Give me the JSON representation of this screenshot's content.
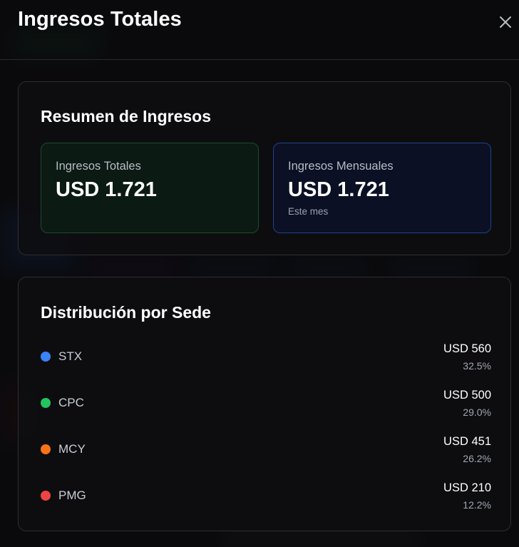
{
  "modal": {
    "title": "Ingresos Totales",
    "close_icon": "close-icon"
  },
  "summary": {
    "title": "Resumen de Ingresos",
    "total": {
      "label": "Ingresos Totales",
      "value": "USD 1.721",
      "accent": "#1d4a2e"
    },
    "monthly": {
      "label": "Ingresos Mensuales",
      "value": "USD 1.721",
      "note": "Este mes",
      "accent": "#24408f"
    }
  },
  "distribution": {
    "title": "Distribución por Sede",
    "items": [
      {
        "name": "STX",
        "amount": "USD 560",
        "percent": "32.5%",
        "color": "#3b82f6"
      },
      {
        "name": "CPC",
        "amount": "USD 500",
        "percent": "29.0%",
        "color": "#22c55e"
      },
      {
        "name": "MCY",
        "amount": "USD 451",
        "percent": "26.2%",
        "color": "#f97316"
      },
      {
        "name": "PMG",
        "amount": "USD 210",
        "percent": "12.2%",
        "color": "#ef4444"
      }
    ]
  }
}
